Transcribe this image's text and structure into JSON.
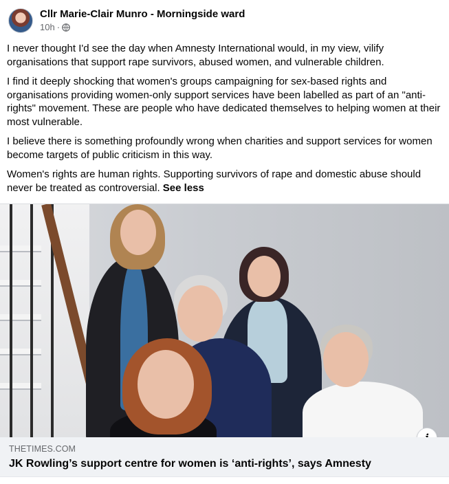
{
  "post": {
    "author": "Cllr Marie-Clair Munro - Morningside ward",
    "time": "10h",
    "separator": "·",
    "audience_icon": "globe-icon",
    "paragraphs": [
      "I never thought I'd see the day when Amnesty International would, in my view, vilify organisations that support rape survivors, abused women, and vulnerable children.",
      "I find it deeply shocking that women's groups campaigning for sex-based rights and organisations providing women-only support services have been labelled as part of an \"anti-rights\" movement. These are people who have dedicated themselves to helping women at their most vulnerable.",
      "I believe there is something profoundly wrong when charities and support services for women become targets of public criticism in this way.",
      "Women's rights are human rights. Supporting survivors of rape and domestic abuse should never be treated as controversial."
    ],
    "see_less_label": "See less"
  },
  "link_card": {
    "domain": "THETIMES.COM",
    "headline": "JK Rowling’s support centre for women is ‘anti-rights’, says Amnesty",
    "info_icon": "info-icon",
    "info_label": "i"
  },
  "colors": {
    "text": "#050505",
    "secondary": "#65676b",
    "card_bg": "#f0f2f5"
  }
}
